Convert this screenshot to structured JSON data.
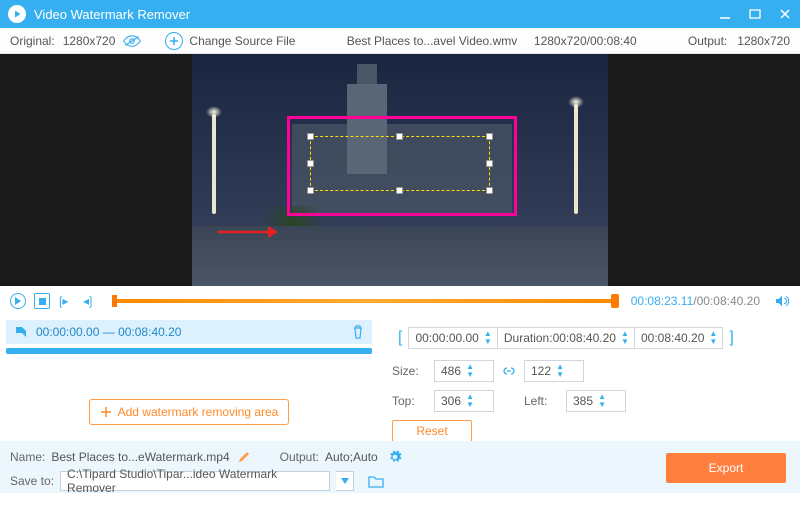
{
  "titlebar": {
    "title": "Video Watermark Remover"
  },
  "infobar": {
    "original_label": "Original:",
    "original_res": "1280x720",
    "change_source": "Change Source File",
    "filename": "Best Places to...avel Video.wmv",
    "file_meta": "1280x720/00:08:40",
    "output_label": "Output:",
    "output_res": "1280x720"
  },
  "playbar": {
    "current": "00:08:23.11",
    "total": "/00:08:40.20"
  },
  "segment": {
    "start": "00:00:00.00",
    "end": "00:08:40.20"
  },
  "left": {
    "add_label": "Add watermark removing area"
  },
  "right": {
    "start": "00:00:00.00",
    "duration_label": "Duration:",
    "duration": "00:08:40.20",
    "end": "00:08:40.20",
    "size_label": "Size:",
    "width": "486",
    "height": "122",
    "top_label": "Top:",
    "top": "306",
    "left_label": "Left:",
    "left": "385",
    "reset": "Reset"
  },
  "footer": {
    "name_label": "Name:",
    "name_val": "Best Places to...eWatermark.mp4",
    "output_label": "Output:",
    "output_val": "Auto;Auto",
    "saveto_label": "Save to:",
    "saveto_val": "C:\\Tipard Studio\\Tipar...ideo Watermark Remover",
    "export": "Export"
  }
}
